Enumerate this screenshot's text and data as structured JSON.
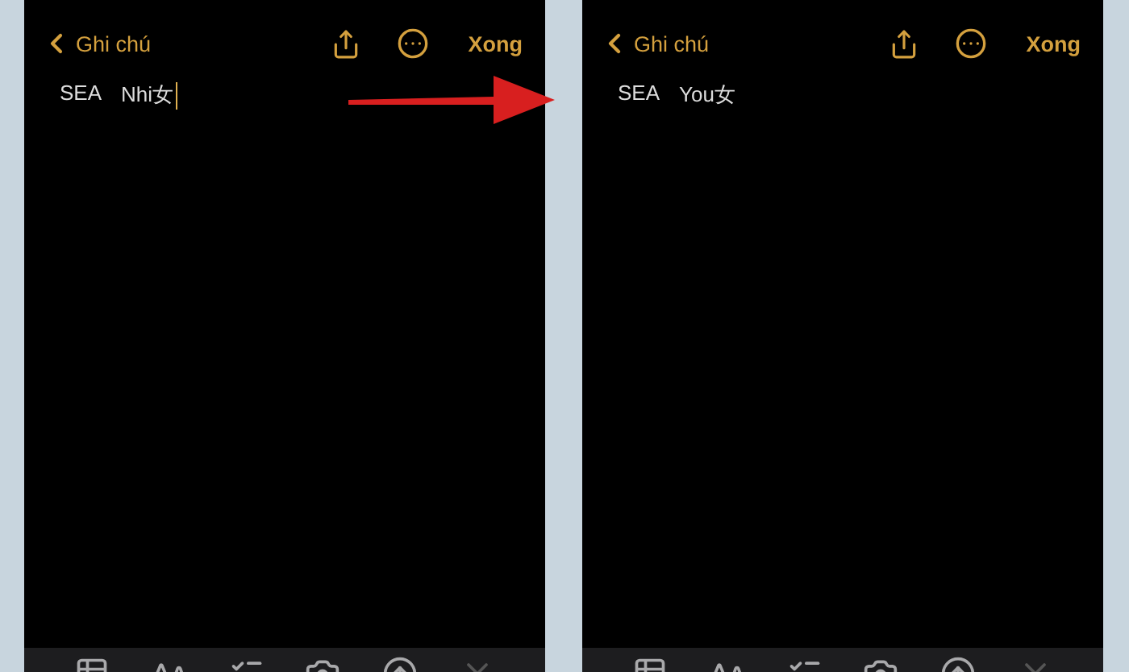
{
  "screens": [
    {
      "back": "Ghi chú",
      "done": "Xong",
      "note_words": [
        "SEA",
        "Nhi女"
      ],
      "cursor": true,
      "toolbar": [
        {
          "kind": "table"
        },
        {
          "kind": "text"
        },
        {
          "kind": "checklist"
        },
        {
          "kind": "camera"
        },
        {
          "kind": "markup"
        },
        {
          "kind": "close"
        }
      ]
    },
    {
      "back": "Ghi chú",
      "done": "Xong",
      "note_words": [
        "SEA",
        "You女"
      ],
      "cursor": false,
      "toolbar": [
        {
          "kind": "table"
        },
        {
          "kind": "text"
        },
        {
          "kind": "checklist"
        },
        {
          "kind": "camera"
        },
        {
          "kind": "markup"
        },
        {
          "kind": "close"
        }
      ]
    }
  ]
}
